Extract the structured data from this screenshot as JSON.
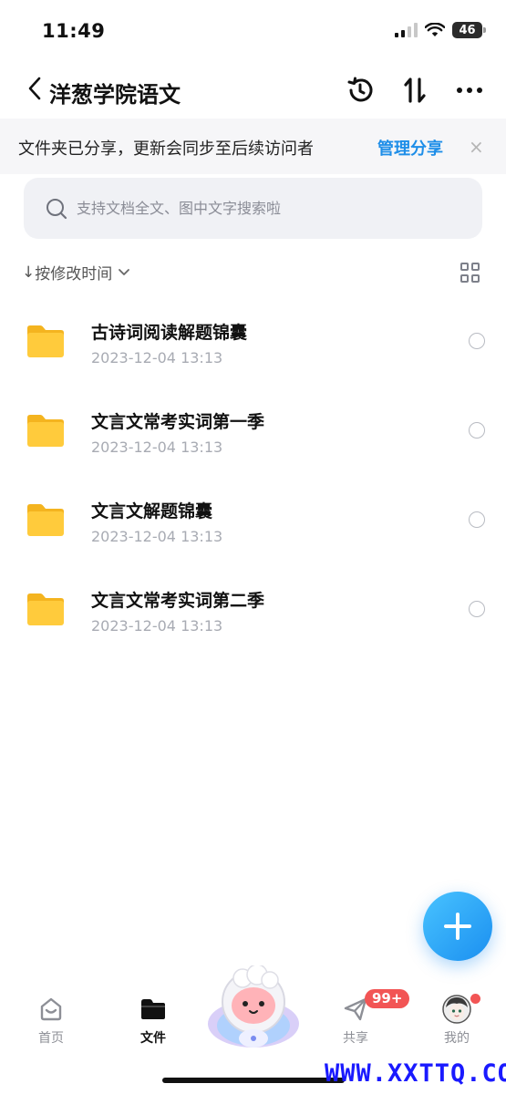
{
  "status_bar": {
    "time": "11:49",
    "battery": "46"
  },
  "nav": {
    "title": "洋葱学院语文"
  },
  "share_banner": {
    "message": "文件夹已分享，更新会同步至后续访问者",
    "action": "管理分享",
    "close": "×"
  },
  "search": {
    "placeholder": "支持文档全文、图中文字搜索啦"
  },
  "sort": {
    "arrow": "↓",
    "label": "按修改时间"
  },
  "files": [
    {
      "name": "古诗词阅读解题锦囊",
      "modified": "2023-12-04 13:13"
    },
    {
      "name": "文言文常考实词第一季",
      "modified": "2023-12-04 13:13"
    },
    {
      "name": "文言文解题锦囊",
      "modified": "2023-12-04 13:13"
    },
    {
      "name": "文言文常考实词第二季",
      "modified": "2023-12-04 13:13"
    }
  ],
  "tabbar": {
    "home": "首页",
    "files": "文件",
    "share": "共享",
    "share_badge": "99+",
    "mine": "我的"
  },
  "watermark": "WWW.XXTTQ.COM",
  "colors": {
    "accent": "#1e8ee8",
    "folder": "#ffc93a",
    "badge": "#f25555"
  }
}
